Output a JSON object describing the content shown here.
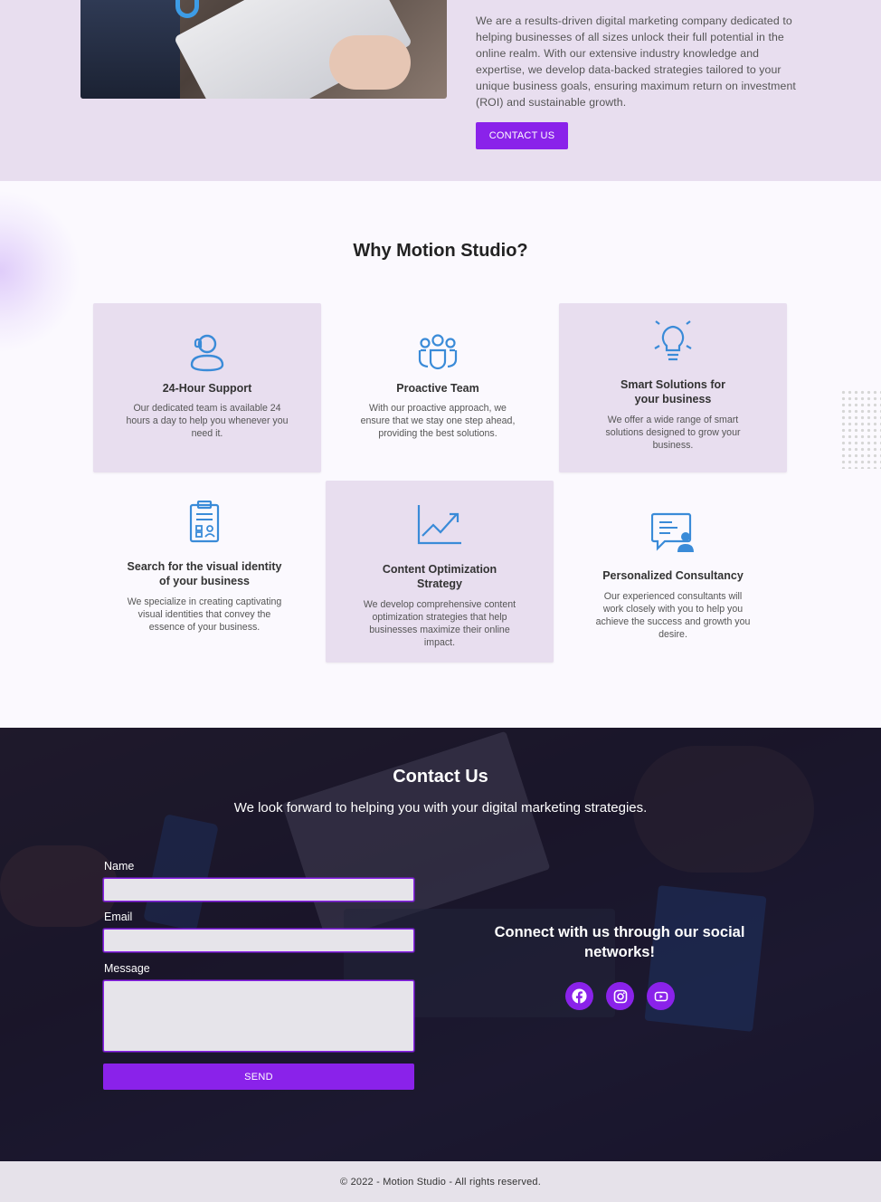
{
  "about": {
    "text": "We are a results-driven digital marketing company dedicated to helping businesses of all sizes unlock their full potential in the online realm. With our extensive industry knowledge and expertise, we develop data-backed strategies tailored to your unique business goals, ensuring maximum return on investment (ROI) and sustainable growth.",
    "button_label": "CONTACT US"
  },
  "why": {
    "title": "Why Motion Studio?",
    "cards": [
      {
        "icon": "support-agent-icon",
        "title": "24-Hour Support",
        "text": "Our dedicated team is available 24 hours a day to help you whenever you need it."
      },
      {
        "icon": "team-icon",
        "title": "Proactive Team",
        "text": "With our proactive approach, we ensure that we stay one step ahead, providing the best solutions."
      },
      {
        "icon": "lightbulb-icon",
        "title": "Smart Solutions for your business",
        "text": "We offer a wide range of smart solutions designed to grow your business."
      },
      {
        "icon": "clipboard-icon",
        "title": "Search for the visual identity of your business",
        "text": "We specialize in creating captivating visual identities that convey the essence of your business."
      },
      {
        "icon": "growth-chart-icon",
        "title": "Content Optimization Strategy",
        "text": "We develop comprehensive content optimization strategies that help businesses maximize their online impact."
      },
      {
        "icon": "consultancy-icon",
        "title": "Personalized Consultancy",
        "text": "Our experienced consultants will work closely with you to help you achieve the success and growth you desire."
      }
    ]
  },
  "contact": {
    "title": "Contact Us",
    "subtitle": "We look forward to helping you with your digital marketing strategies.",
    "name_label": "Name",
    "email_label": "Email",
    "message_label": "Message",
    "name_value": "",
    "email_value": "",
    "message_value": "",
    "send_label": "SEND",
    "social_title": "Connect with us through our social networks!",
    "social_icons": [
      "facebook-icon",
      "instagram-icon",
      "youtube-icon"
    ]
  },
  "colors": {
    "accent": "#8a22ea",
    "icon_blue": "#3a8bd8",
    "section_bg": "#e8deef"
  },
  "footer": {
    "text": "© 2022 - Motion Studio - All rights reserved."
  }
}
